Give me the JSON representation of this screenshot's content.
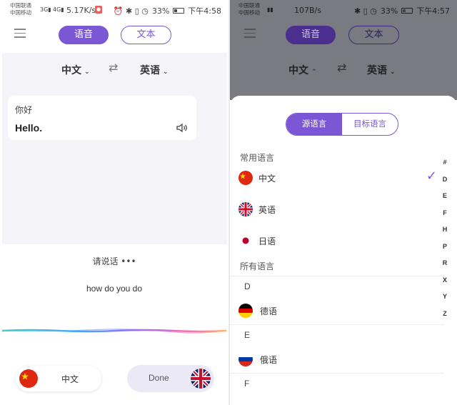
{
  "left": {
    "status": {
      "carrier1": "中国联通",
      "carrier2": "中国移动",
      "net1": "3G",
      "net2": "4G",
      "speed": "5.17K/s",
      "icons": "⏰ ✱ ▯ ◷",
      "battery": "33%",
      "time": "下午4:58"
    },
    "header": {
      "voice_tab": "语音",
      "text_tab": "文本"
    },
    "langs": {
      "source": "中文",
      "target": "英语"
    },
    "card": {
      "source_text": "你好",
      "translated_text": "Hello."
    },
    "prompt": "请说话",
    "dots": "•••",
    "recognized": "how do you do",
    "bottom": {
      "left_lang": "中文",
      "done": "Done"
    }
  },
  "right": {
    "status": {
      "carrier1": "中国联通",
      "carrier2": "中国移动",
      "speed": "107B/s",
      "icons": "✱ ▯ ◷",
      "battery": "33%",
      "time": "下午4:57"
    },
    "header": {
      "voice_tab": "语音",
      "text_tab": "文本"
    },
    "langs": {
      "source": "中文",
      "target": "英语"
    },
    "sheet": {
      "tab_source": "源语言",
      "tab_target": "目标语言",
      "common_title": "常用语言",
      "common": [
        {
          "name": "中文",
          "flag": "cn",
          "selected": true
        },
        {
          "name": "英语",
          "flag": "uk",
          "selected": false
        },
        {
          "name": "日语",
          "flag": "jp",
          "selected": false
        }
      ],
      "all_title": "所有语言",
      "groups": [
        {
          "letter": "D",
          "items": [
            {
              "name": "德语",
              "flag": "de"
            }
          ]
        },
        {
          "letter": "E",
          "items": [
            {
              "name": "俄语",
              "flag": "ru"
            }
          ]
        },
        {
          "letter": "F",
          "items": []
        }
      ],
      "index": [
        "#",
        "D",
        "E",
        "F",
        "H",
        "P",
        "R",
        "X",
        "Y",
        "Z"
      ]
    }
  },
  "colors": {
    "accent": "#7b57d6",
    "gray_bg": "#f4f4f9",
    "overlay": "#7a7a82"
  }
}
